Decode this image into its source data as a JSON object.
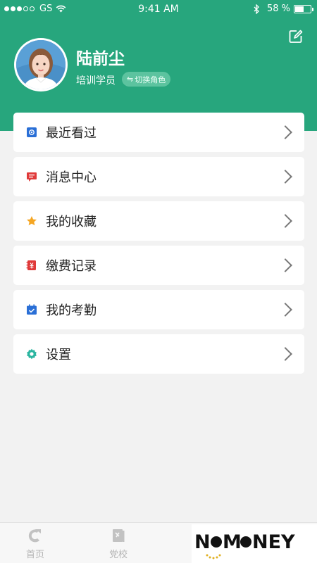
{
  "status_bar": {
    "carrier": "GS",
    "time": "9:41 AM",
    "battery_percent": "58 %",
    "battery_level": 0.58
  },
  "profile": {
    "name": "陆前尘",
    "role": "培训学员",
    "switch_role_label": "切换角色"
  },
  "menu": {
    "items": [
      {
        "label": "最近看过",
        "icon": "recent-icon",
        "color": "#2a6fd6"
      },
      {
        "label": "消息中心",
        "icon": "message-icon",
        "color": "#e03a3a"
      },
      {
        "label": "我的收藏",
        "icon": "star-icon",
        "color": "#f5a623"
      },
      {
        "label": "缴费记录",
        "icon": "payment-icon",
        "color": "#e03a3a"
      },
      {
        "label": "我的考勤",
        "icon": "attendance-icon",
        "color": "#2a6fd6"
      },
      {
        "label": "设置",
        "icon": "gear-icon",
        "color": "#2bb5a0"
      }
    ]
  },
  "tabbar": {
    "home_label": "首页",
    "school_label": "党校"
  },
  "watermark": {
    "text": "NOMONEY"
  },
  "colors": {
    "primary": "#27a67d",
    "background": "#f2f2f2"
  }
}
